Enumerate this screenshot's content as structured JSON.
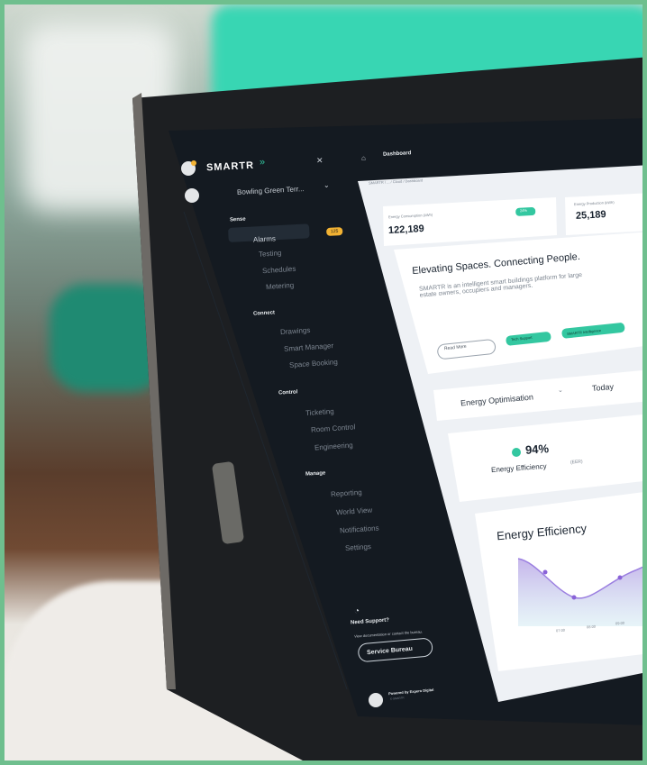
{
  "brand": "SMARTR",
  "site": "Bowling Green Terr...",
  "topbar": {
    "title": "Dashboard",
    "breadcrumb": "SMARTR  /  ...  /  Cloud  /  Dashboard"
  },
  "sidebar": {
    "sections": [
      {
        "label": "Sense",
        "items": [
          "Alarms",
          "Testing",
          "Schedules",
          "Metering"
        ]
      },
      {
        "label": "Connect",
        "items": [
          "Drawings",
          "Smart Manager",
          "Space Booking"
        ]
      },
      {
        "label": "Control",
        "items": [
          "Ticketing",
          "Room Control",
          "Engineering"
        ]
      },
      {
        "label": "Manage",
        "items": [
          "Reporting",
          "World View",
          "Notifications",
          "Settings"
        ]
      }
    ],
    "alarm_badge": "125",
    "support": {
      "title": "Need Support?",
      "text": "View documentation or contact the bureau.",
      "button": "Service Bureau"
    },
    "footer": {
      "powered": "Powered by Expero Digital",
      "sub": "© SMARTR"
    }
  },
  "metrics": [
    {
      "label": "Energy Consumption (kWh)",
      "value": "122,189",
      "badge": "24%"
    },
    {
      "label": "Energy Production (kWh)",
      "value": "25,189"
    }
  ],
  "hero": {
    "title": "Elevating Spaces. Connecting People.",
    "text": "SMARTR is an intelligent smart buildings platform for large estate owners, occupiers and managers.",
    "read_more": "Read More",
    "tags": [
      "Tech Support",
      "SMARTR Intelligence"
    ]
  },
  "filter": {
    "select": "Energy Optimisation",
    "period": "Today"
  },
  "efficiency": {
    "value": "94%",
    "label": "Energy Efficiency",
    "unit": "(EER)"
  },
  "chart_card": {
    "title": "Energy Efficiency",
    "ticks": [
      "07:00",
      "08:00",
      "09:00"
    ]
  },
  "colors": {
    "accent": "#33c7a0",
    "badge": "#f2b233",
    "sidebar": "#141a21",
    "screen_bg": "#eef1f5"
  },
  "icons": [
    "home-icon",
    "close-icon",
    "bell-icon",
    "gear-icon",
    "help-icon",
    "chevron-down-icon"
  ]
}
